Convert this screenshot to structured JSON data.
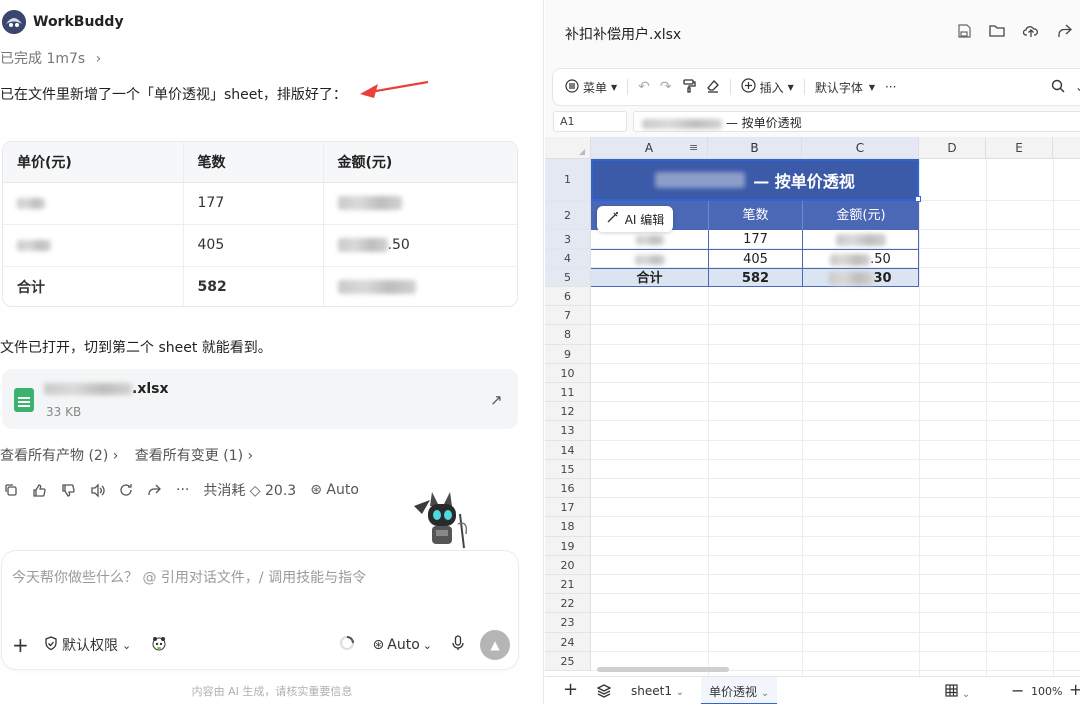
{
  "app": {
    "name": "WorkBuddy"
  },
  "chat": {
    "status": "已完成 1m7s",
    "message": "已在文件里新增了一个「单价透视」sheet，排版好了：",
    "table": {
      "headers": [
        "单价(元)",
        "笔数",
        "金额(元)"
      ],
      "rows": [
        {
          "price": "",
          "count": "177",
          "amount": ""
        },
        {
          "price": "",
          "count": "405",
          "amount": ".50"
        },
        {
          "price": "合计",
          "count": "582",
          "amount": ""
        }
      ]
    },
    "note": "文件已打开，切到第二个 sheet 就能看到。",
    "file": {
      "name_suffix": ".xlsx",
      "size": "33 KB"
    },
    "links": {
      "products": "查看所有产物 (2)",
      "changes": "查看所有变更 (1)"
    },
    "consumption": "共消耗 ◇ 20.3",
    "auto_label": "Auto",
    "ellipsis": "···"
  },
  "composer": {
    "placeholder": "今天帮你做些什么？ @ 引用对话文件，/ 调用技能与指令",
    "permission": "默认权限",
    "mode": "Auto",
    "footer": "内容由 AI 生成，请核实重要信息"
  },
  "sheet_app": {
    "title": "补扣补偿用户.xlsx",
    "toolbar": {
      "menu": "菜单",
      "insert": "插入",
      "font": "默认字体",
      "more": "···"
    },
    "cell_ref": "A1",
    "formula": "— 按单价透视",
    "columns": [
      "A",
      "B",
      "C",
      "D",
      "E"
    ],
    "rows": [
      "1",
      "2",
      "3",
      "4",
      "5",
      "6",
      "7",
      "8",
      "9",
      "10",
      "11",
      "12",
      "13",
      "14",
      "15",
      "16",
      "17",
      "18",
      "19",
      "20",
      "21",
      "22",
      "23",
      "24",
      "25"
    ],
    "title_cell": "— 按单价透视",
    "header_cells": [
      "笔数",
      "金额(元)"
    ],
    "ai_edit": "AI 编辑",
    "data_cells": [
      {
        "a": "",
        "b": "177",
        "c": ""
      },
      {
        "a": "",
        "b": "405",
        "c": ".50"
      },
      {
        "a": "合计",
        "b": "582",
        "c": "30"
      }
    ],
    "tabs": [
      "sheet1",
      "单价透视"
    ],
    "active_tab": "单价透视",
    "zoom": "100%",
    "accent": "#3b5aa8",
    "header_fill": "#4a68b5",
    "total_fill": "#dbe5f1"
  }
}
